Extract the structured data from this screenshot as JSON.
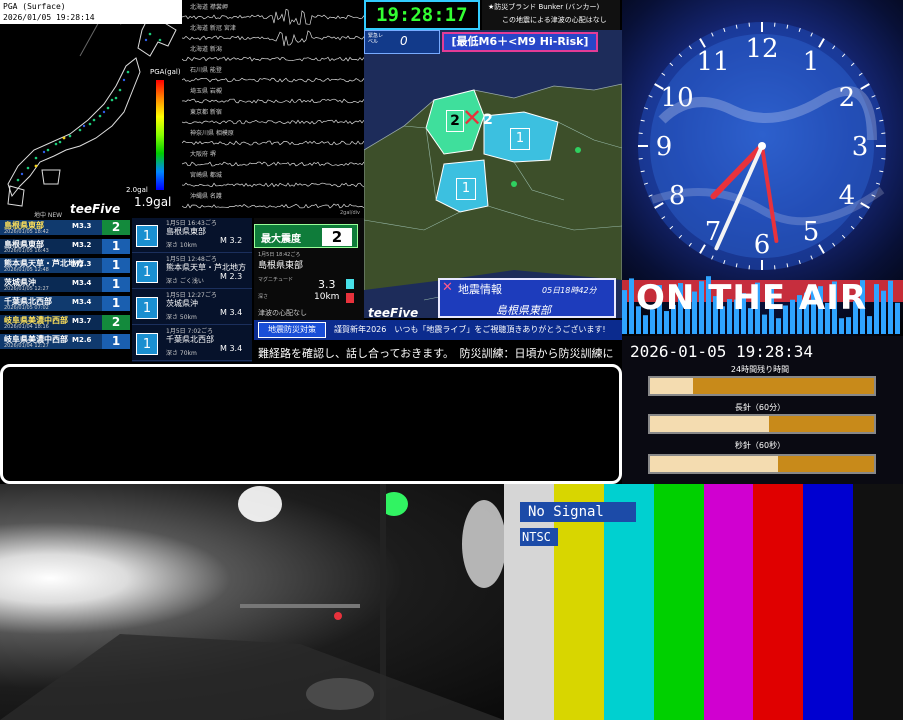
{
  "pga": {
    "title": "PGA (Surface)",
    "timestamp": "2026/01/05 19:28:14",
    "scale_label": "PGA(gal)",
    "min_label": "2.0gal",
    "value": "1.9gal"
  },
  "waveform": {
    "stations": [
      "北海道 襟裳岬",
      "北海道 新冠 宮津",
      "北海道 新潟",
      "石川県 能登",
      "埼玉県 岩槻",
      "東京都 新宿",
      "神奈川県 相模原",
      "大阪府 堺",
      "宮崎県 都城",
      "沖縄県 名護"
    ],
    "unit": "2gal/div"
  },
  "list_header": {
    "new_label": "地中 NEW",
    "brand": "teeFive"
  },
  "eq_list": [
    {
      "name": "島根県東部",
      "date": "2026/01/05 18:42",
      "mag": "M3.3",
      "shindo": "2",
      "color": "#138a3c"
    },
    {
      "name": "島根県東部",
      "date": "2026/01/05 16:43",
      "mag": "M3.2",
      "shindo": "1",
      "color": "#1a5fb0"
    },
    {
      "name": "熊本県天草・芦北地方",
      "date": "2026/01/05 12:48",
      "mag": "M2.3",
      "shindo": "1",
      "color": "#1a5fb0"
    },
    {
      "name": "茨城県沖",
      "date": "2026/01/05 12:27",
      "mag": "M3.4",
      "shindo": "1",
      "color": "#1a5fb0"
    },
    {
      "name": "千葉県北西部",
      "date": "2026/01/05 07:02",
      "mag": "M3.4",
      "shindo": "1",
      "color": "#1a5fb0"
    },
    {
      "name": "岐阜県美濃中西部",
      "date": "2026/01/04 18:16",
      "mag": "M3.7",
      "shindo": "2",
      "color": "#138a3c"
    },
    {
      "name": "岐阜県美濃中西部",
      "date": "2026/01/04 12:27",
      "mag": "M2.6",
      "shindo": "1",
      "color": "#1a5fb0"
    }
  ],
  "eq_detail": [
    {
      "shindo": "1",
      "place": "島根県東部",
      "time": "1月5日 16:43ごろ",
      "depth": "深さ 10km",
      "mag": "M 3.2"
    },
    {
      "shindo": "1",
      "place": "熊本県天草・芦北地方",
      "time": "1月5日 12:48ごろ",
      "depth": "深さ ごく浅い",
      "mag": "M 2.3"
    },
    {
      "shindo": "1",
      "place": "茨城県沖",
      "time": "1月5日 12:27ごろ",
      "depth": "深さ 50km",
      "mag": "M 3.4"
    },
    {
      "shindo": "1",
      "place": "千葉県北西部",
      "time": "1月5日 7:02ごろ",
      "depth": "深さ 70km",
      "mag": "M 3.4"
    }
  ],
  "max_shindo": {
    "label": "最大震度",
    "value": "2",
    "time": "1月5日 18:42ごろ",
    "place": "島根県東部",
    "mag_label": "マグニチュード",
    "mag": "3.3",
    "depth_label": "深さ",
    "depth": "10km",
    "tsunami": "津波の心配なし"
  },
  "clock_bar": {
    "time": "19:28:17"
  },
  "bunker": {
    "line1": "★防災ブランド Bunker (バンカー)",
    "line2": "この地震による津波の心配はなし"
  },
  "map_overlay": {
    "alert_label": "緊急レベル",
    "alert_value": "0",
    "risk": "[最低M6＋<M9 Hi-Risk]",
    "brand": "teeFive",
    "info_title": "地震情報",
    "info_time": "05日18時42分",
    "info_place": "島根県東部",
    "epicenter_shindo_left": "2",
    "epicenter_shindo_right": "2",
    "region_shindo": [
      "1",
      "1"
    ]
  },
  "ticker": {
    "tag": "地震防災対策",
    "text1": "謹賀新年2026　いつも「地震ライブ」をご視聴頂きありがとうございます!",
    "text2": "難経路を確認し、話し合っておきます。　防災訓練：日頃から防災訓練に"
  },
  "clock": {
    "numbers": [
      "12",
      "1",
      "2",
      "3",
      "4",
      "5",
      "6",
      "7",
      "8",
      "9",
      "10",
      "11"
    ],
    "hour": 7,
    "minute": 28,
    "second": 34
  },
  "on_air": "ON THE AIR",
  "datetime": "2026-01-05 19:28:34",
  "progress": [
    {
      "label": "24時間残り時間",
      "fraction": 0.19
    },
    {
      "label": "長針（60分）",
      "fraction": 0.53
    },
    {
      "label": "秒針（60秒）",
      "fraction": 0.57
    }
  ],
  "test_signal": {
    "no_signal": "No Signal",
    "standard": "NTSC",
    "bar_colors": [
      "#d6d6d6",
      "#d8d600",
      "#00d0d0",
      "#00d000",
      "#d000d0",
      "#e00000",
      "#0000d0",
      "#111111"
    ]
  }
}
